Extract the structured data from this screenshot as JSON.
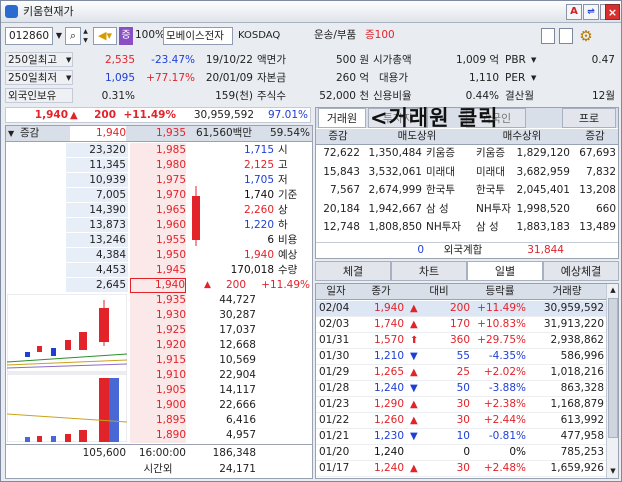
{
  "window": {
    "title": "키움현재가",
    "buttons": [
      "A",
      "?",
      "×"
    ]
  },
  "toolbar": {
    "code": "012860",
    "jong_badge": "증",
    "margin_pct": "100%",
    "stock_name": "모베이스전자",
    "market": "KOSDAQ",
    "sector": "운송/부품",
    "margin_group": "증100"
  },
  "info": {
    "r1": {
      "label": "250일최고",
      "price": "2,535",
      "pct": "-23.47%",
      "date": "19/10/22",
      "k1": "액면가",
      "v1": "500 원",
      "k2": "시가총액",
      "v2": "1,009 억",
      "k3": "PBR",
      "v3": "0.47"
    },
    "r2": {
      "label": "250일최저",
      "price": "1,095",
      "pct": "+77.17%",
      "date": "20/01/09",
      "k1": "자본금",
      "v1": "260 억",
      "k2": "대용가",
      "v2": "1,110",
      "k3": "PER",
      "v3": ""
    },
    "r3": {
      "label": "외국인보유",
      "val": "0.31%",
      "val2": "159(천)",
      "k1": "주식수",
      "v1": "52,000 천",
      "k2": "신용비율",
      "v2": "0.44%",
      "k3": "결산월",
      "v3": "12월"
    }
  },
  "quote": {
    "price": "1,940",
    "change": "200",
    "pct": "+11.49%",
    "volume": "30,959,592",
    "vol_ratio": "97.01%",
    "col_header": "증감",
    "cur_price": "1,940",
    "ref_price": "1,935",
    "amount": "61,560백만",
    "rate": "59.54%"
  },
  "asks": [
    {
      "qty": "23,320",
      "price": "1,985"
    },
    {
      "qty": "11,345",
      "price": "1,980"
    },
    {
      "qty": "10,939",
      "price": "1,975"
    },
    {
      "qty": "7,005",
      "price": "1,970"
    },
    {
      "qty": "14,390",
      "price": "1,965"
    },
    {
      "qty": "13,873",
      "price": "1,960"
    },
    {
      "qty": "13,246",
      "price": "1,955"
    },
    {
      "qty": "4,384",
      "price": "1,950"
    },
    {
      "qty": "4,453",
      "price": "1,945"
    },
    {
      "qty": "2,645",
      "price": "1,940"
    }
  ],
  "bids": [
    {
      "price": "1,935",
      "qty": "44,727"
    },
    {
      "price": "1,930",
      "qty": "30,287"
    },
    {
      "price": "1,925",
      "qty": "17,037"
    },
    {
      "price": "1,920",
      "qty": "12,668"
    },
    {
      "price": "1,915",
      "qty": "10,569"
    },
    {
      "price": "1,910",
      "qty": "22,904"
    },
    {
      "price": "1,905",
      "qty": "14,117"
    },
    {
      "price": "1,900",
      "qty": "22,666"
    },
    {
      "price": "1,895",
      "qty": "6,416"
    },
    {
      "price": "1,890",
      "qty": "4,957"
    }
  ],
  "side_info": [
    {
      "val": "1,715",
      "lab": "시"
    },
    {
      "val": "2,125",
      "lab": "고"
    },
    {
      "val": "1,705",
      "lab": "저"
    },
    {
      "val": "1,740",
      "lab": "기준"
    },
    {
      "val": "2,260",
      "lab": "상"
    },
    {
      "val": "1,220",
      "lab": "하"
    },
    {
      "val": "6",
      "lab": "비용"
    },
    {
      "val": "1,940",
      "lab": "예상"
    },
    {
      "val": "170,018",
      "lab": "수량"
    }
  ],
  "expected": {
    "change": "200",
    "pct": "+11.49%"
  },
  "totals": {
    "ask_total": "105,600",
    "time": "16:00:00",
    "bid_total": "186,348",
    "after_label": "시간외",
    "after_qty": "24,171"
  },
  "broker": {
    "tabs": [
      "거래원",
      "투자자",
      "외국인",
      "프로"
    ],
    "overlay": "<거래원 클릭",
    "headers": [
      "증감",
      "매도상위",
      "매수상위",
      "증감"
    ],
    "rows": [
      {
        "d1": "72,622",
        "q1": "1,350,484",
        "n1": "키움증",
        "n2": "키움증",
        "q2": "1,829,120",
        "d2": "67,693"
      },
      {
        "d1": "15,843",
        "q1": "3,532,061",
        "n1": "미래대",
        "n2": "미래대",
        "q2": "3,682,959",
        "d2": "7,832"
      },
      {
        "d1": "7,567",
        "q1": "2,674,999",
        "n1": "한국투",
        "n2": "한국투",
        "q2": "2,045,401",
        "d2": "13,208"
      },
      {
        "d1": "20,184",
        "q1": "1,942,667",
        "n1": "삼  성",
        "n2": "NH투자",
        "q2": "1,998,520",
        "d2": "660"
      },
      {
        "d1": "12,748",
        "q1": "1,808,850",
        "n1": "NH투자",
        "n2": "삼  성",
        "q2": "1,883,183",
        "d2": "13,489"
      }
    ],
    "foreign": {
      "sell": "0",
      "label": "외국계합",
      "buy": "31,844"
    }
  },
  "bottom_tabs": [
    "체결",
    "차트",
    "일별",
    "예상체결"
  ],
  "daily": {
    "headers": [
      "일자",
      "종가",
      "대비",
      "등락률",
      "거래량"
    ],
    "rows": [
      {
        "date": "02/04",
        "close": "1,940",
        "dir": "up",
        "chg": "200",
        "pct": "+11.49%",
        "vol": "30,959,592"
      },
      {
        "date": "02/03",
        "close": "1,740",
        "dir": "up",
        "chg": "170",
        "pct": "+10.83%",
        "vol": "31,913,220"
      },
      {
        "date": "01/31",
        "close": "1,570",
        "dir": "limit",
        "chg": "360",
        "pct": "+29.75%",
        "vol": "2,938,862"
      },
      {
        "date": "01/30",
        "close": "1,210",
        "dir": "down",
        "chg": "55",
        "pct": "-4.35%",
        "vol": "586,996"
      },
      {
        "date": "01/29",
        "close": "1,265",
        "dir": "up",
        "chg": "25",
        "pct": "+2.02%",
        "vol": "1,018,216"
      },
      {
        "date": "01/28",
        "close": "1,240",
        "dir": "down",
        "chg": "50",
        "pct": "-3.88%",
        "vol": "863,328"
      },
      {
        "date": "01/23",
        "close": "1,290",
        "dir": "up",
        "chg": "30",
        "pct": "+2.38%",
        "vol": "1,168,879"
      },
      {
        "date": "01/22",
        "close": "1,260",
        "dir": "up",
        "chg": "30",
        "pct": "+2.44%",
        "vol": "613,992"
      },
      {
        "date": "01/21",
        "close": "1,230",
        "dir": "down",
        "chg": "10",
        "pct": "-0.81%",
        "vol": "477,958"
      },
      {
        "date": "01/20",
        "close": "1,240",
        "dir": "flat",
        "chg": "0",
        "pct": "0%",
        "vol": "785,253"
      },
      {
        "date": "01/17",
        "close": "1,240",
        "dir": "up",
        "chg": "30",
        "pct": "+2.48%",
        "vol": "1,659,926"
      }
    ]
  },
  "colors": {
    "up": "#e2232a",
    "down": "#1f3fd6",
    "ask_bg": "#e8eef8",
    "bid_bg": "#fbe9e9"
  }
}
